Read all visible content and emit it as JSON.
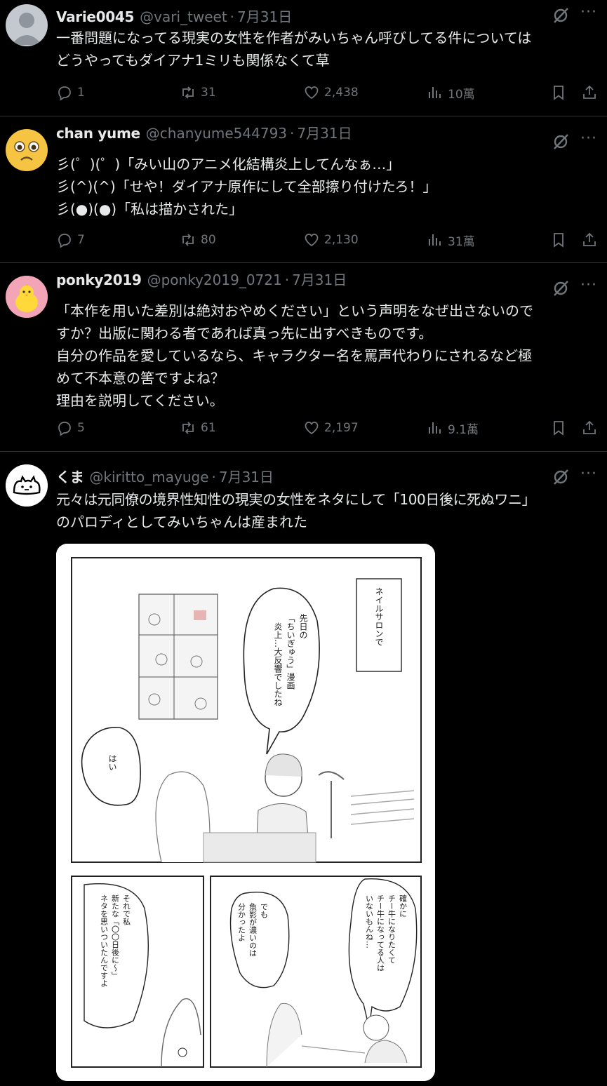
{
  "tweets": [
    {
      "name": "Varie0045",
      "handle": "@vari_tweet",
      "dot": "·",
      "date": "7月31日",
      "lines": [
        "一番問題になってる現実の女性を作者がみいちゃん呼びしてる件については",
        "どうやってもダイアナ1ミリも関係なくて草"
      ],
      "replies": "1",
      "retweets": "31",
      "likes": "2,438",
      "views": "10萬"
    },
    {
      "name": "chan yume",
      "handle": "@chanyume544793",
      "dot": "·",
      "date": "7月31日",
      "lines": [
        "彡(゜)(゜)「みい山のアニメ化結構炎上してんなぁ…」",
        "彡(^)(^)「せや！ダイアナ原作にして全部擦り付けたろ！」",
        "彡(●)(●)「私は描かされた」"
      ],
      "replies": "7",
      "retweets": "80",
      "likes": "2,130",
      "views": "31萬"
    },
    {
      "name": "ponky2019",
      "handle": "@ponky2019_0721",
      "dot": "·",
      "date": "7月31日",
      "lines": [
        "「本作を用いた差別は絶対おやめください」という声明をなぜ出さないので",
        "すか？出版に関わる者であれば真っ先に出すべきものです。",
        "自分の作品を愛しているなら、キャラクター名を罵声代わりにされるなど極",
        "めて不本意の筈ですよね？",
        "理由を説明してください。"
      ],
      "replies": "5",
      "retweets": "61",
      "likes": "2,197",
      "views": "9.1萬"
    },
    {
      "name": "くま",
      "handle": "@kiritto_mayuge",
      "dot": "·",
      "date": "7月31日",
      "lines": [
        "元々は元同僚の境界性知性の現実の女性をネタにして「100日後に死ぬワニ」",
        "のパロディとしてみいちゃんは産まれた"
      ]
    }
  ],
  "manga": {
    "caption_box": "ネイルサロンで",
    "bubble_main": [
      "先日の",
      "「ちいぎゅう」漫画",
      "炎上…大反響でしたね"
    ],
    "bubble_reply": "はい",
    "panel2_bubble": [
      "それで私",
      "新たな「〇〇日後に〜」",
      "ネタを思いついたんですよ"
    ],
    "panel3_bubble_right": [
      "確かに",
      "チー牛になりたくて",
      "チー牛になってる人は",
      "いないもんね…"
    ],
    "panel3_bubble_left": [
      "でも",
      "魚影が濃いのは",
      "分かったよ"
    ]
  },
  "colors": {
    "background": "#000000",
    "text": "#e7e9ea",
    "muted": "#71767b",
    "divider": "#2f3336"
  }
}
